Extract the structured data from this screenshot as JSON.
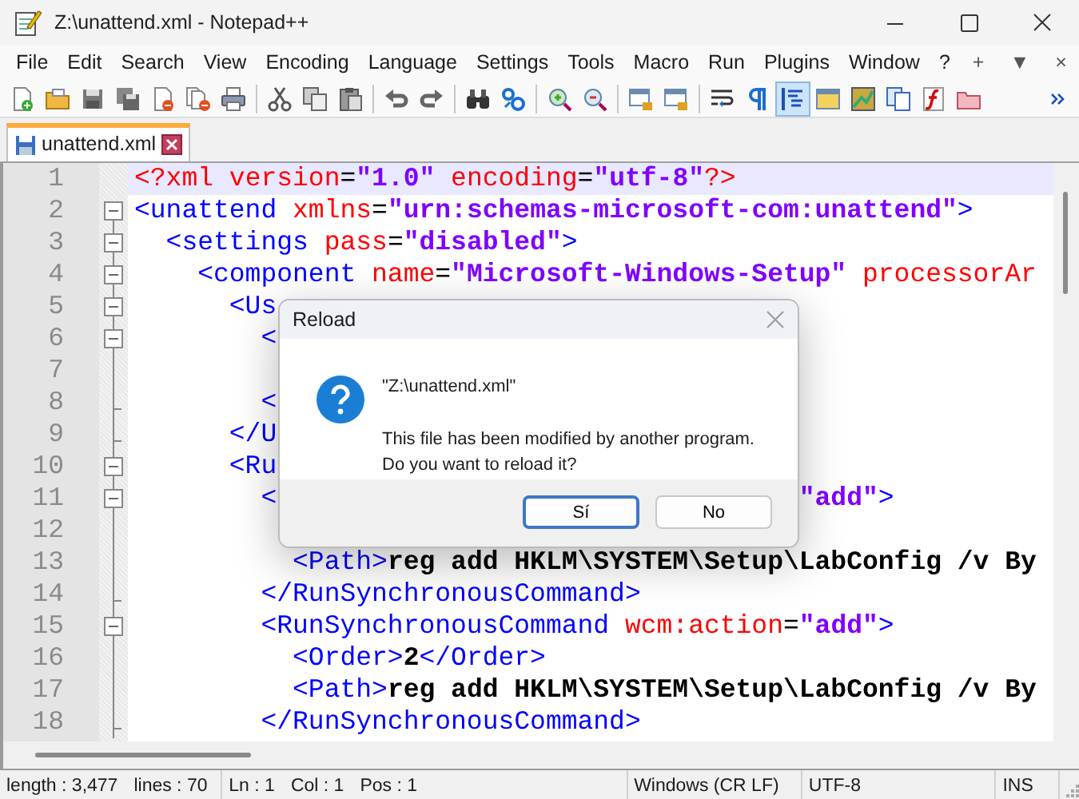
{
  "window": {
    "title": "Z:\\unattend.xml - Notepad++"
  },
  "menu": [
    "File",
    "Edit",
    "Search",
    "View",
    "Encoding",
    "Language",
    "Settings",
    "Tools",
    "Macro",
    "Run",
    "Plugins",
    "Window",
    "?"
  ],
  "menu_right": [
    "+",
    "▼",
    "×"
  ],
  "toolbar": [
    {
      "on": false
    },
    {
      "on": false
    },
    {
      "on": false
    },
    {
      "on": false
    },
    {
      "on": false
    },
    {
      "on": false
    },
    {
      "on": false
    },
    {
      "on": false
    },
    {
      "on": false
    },
    {
      "on": false
    },
    {
      "on": false
    },
    {
      "on": false
    },
    {
      "on": false
    },
    {
      "on": false
    },
    {
      "on": false
    },
    {
      "on": false
    },
    {
      "on": false
    },
    {
      "on": false
    },
    {
      "on": false
    },
    {
      "on": false
    },
    {
      "on": true
    },
    {
      "on": false
    },
    {
      "on": false
    },
    {
      "on": false
    },
    {
      "on": false
    },
    {
      "on": false
    }
  ],
  "tabs": [
    {
      "label": "unattend.xml",
      "selected": true
    }
  ],
  "editor": {
    "lines": [
      {
        "number": "1",
        "current": true,
        "fold": false,
        "fold_end": false,
        "tokens": [
          {
            "text": "<?xml",
            "kind": "pi"
          },
          {
            "text": " version",
            "kind": "attr"
          },
          {
            "text": "=",
            "kind": "op"
          },
          {
            "text": "\"1.0\"",
            "kind": "val"
          },
          {
            "text": " encoding",
            "kind": "attr"
          },
          {
            "text": "=",
            "kind": "op"
          },
          {
            "text": "\"utf-8\"",
            "kind": "val"
          },
          {
            "text": "?>",
            "kind": "pi"
          }
        ]
      },
      {
        "number": "2",
        "current": false,
        "fold": true,
        "fold_end": false,
        "tokens": [
          {
            "text": "<unattend",
            "kind": "tag"
          },
          {
            "text": " xmlns",
            "kind": "attr"
          },
          {
            "text": "=",
            "kind": "op"
          },
          {
            "text": "\"urn:schemas-microsoft-com:unattend\"",
            "kind": "val"
          },
          {
            "text": ">",
            "kind": "tag"
          }
        ]
      },
      {
        "number": "3",
        "current": false,
        "fold": true,
        "fold_end": false,
        "tokens": [
          {
            "text": "  <settings",
            "kind": "tag"
          },
          {
            "text": " pass",
            "kind": "attr"
          },
          {
            "text": "=",
            "kind": "op"
          },
          {
            "text": "\"disabled\"",
            "kind": "val"
          },
          {
            "text": ">",
            "kind": "tag"
          }
        ]
      },
      {
        "number": "4",
        "current": false,
        "fold": true,
        "fold_end": false,
        "tokens": [
          {
            "text": "    <component",
            "kind": "tag"
          },
          {
            "text": " name",
            "kind": "attr"
          },
          {
            "text": "=",
            "kind": "op"
          },
          {
            "text": "\"Microsoft-Windows-Setup\"",
            "kind": "val"
          },
          {
            "text": " processorAr",
            "kind": "attr"
          }
        ]
      },
      {
        "number": "5",
        "current": false,
        "fold": true,
        "fold_end": false,
        "tokens": [
          {
            "text": "      <Us",
            "kind": "tag"
          }
        ]
      },
      {
        "number": "6",
        "current": false,
        "fold": true,
        "fold_end": false,
        "tokens": [
          {
            "text": "        <",
            "kind": "tag"
          }
        ]
      },
      {
        "number": "7",
        "current": false,
        "fold": false,
        "fold_end": false
      },
      {
        "number": "8",
        "current": false,
        "fold": false,
        "fold_end": true,
        "tokens": [
          {
            "text": "        <",
            "kind": "tag"
          }
        ]
      },
      {
        "number": "9",
        "current": false,
        "fold": false,
        "fold_end": true,
        "tokens": [
          {
            "text": "      </U",
            "kind": "tag"
          }
        ]
      },
      {
        "number": "10",
        "current": false,
        "fold": true,
        "fold_end": false,
        "tokens": [
          {
            "text": "      <Ru",
            "kind": "tag"
          }
        ]
      },
      {
        "number": "11",
        "current": false,
        "fold": true,
        "fold_end": false,
        "tokens": [
          {
            "text": "        <",
            "kind": "tag"
          }
        ],
        "tail": [
          {
            "text": "\"add\"",
            "kind": "val"
          },
          {
            "text": ">",
            "kind": "tag"
          }
        ]
      },
      {
        "number": "12",
        "current": false,
        "fold": false,
        "fold_end": false
      },
      {
        "number": "13",
        "current": false,
        "fold": false,
        "fold_end": false,
        "tokens": [
          {
            "text": "          <Path>",
            "kind": "tag"
          },
          {
            "text": "reg add HKLM\\SYSTEM\\Setup\\LabConfig /v By",
            "kind": "text"
          }
        ]
      },
      {
        "number": "14",
        "current": false,
        "fold": false,
        "fold_end": true,
        "tokens": [
          {
            "text": "        </RunSynchronousCommand>",
            "kind": "tag"
          }
        ]
      },
      {
        "number": "15",
        "current": false,
        "fold": true,
        "fold_end": false,
        "tokens": [
          {
            "text": "        <RunSynchronousCommand",
            "kind": "tag"
          },
          {
            "text": " wcm:action",
            "kind": "attr"
          },
          {
            "text": "=",
            "kind": "op"
          },
          {
            "text": "\"add\"",
            "kind": "val"
          },
          {
            "text": ">",
            "kind": "tag"
          }
        ]
      },
      {
        "number": "16",
        "current": false,
        "fold": false,
        "fold_end": false,
        "tokens": [
          {
            "text": "          <Order>",
            "kind": "tag"
          },
          {
            "text": "2",
            "kind": "text"
          },
          {
            "text": "</Order>",
            "kind": "tag"
          }
        ]
      },
      {
        "number": "17",
        "current": false,
        "fold": false,
        "fold_end": false,
        "tokens": [
          {
            "text": "          <Path>",
            "kind": "tag"
          },
          {
            "text": "reg add HKLM\\SYSTEM\\Setup\\LabConfig /v By",
            "kind": "text"
          }
        ]
      },
      {
        "number": "18",
        "current": false,
        "fold": false,
        "fold_end": true,
        "tokens": [
          {
            "text": "        </RunSynchronousCommand>",
            "kind": "tag"
          }
        ]
      }
    ]
  },
  "dialog": {
    "title": "Reload",
    "file": "\"Z:\\unattend.xml\"",
    "message": [
      "This file has been modified by another program.",
      "Do you want to reload it?"
    ],
    "buttons": [
      {
        "label": "Sí",
        "default": true
      },
      {
        "label": "No",
        "default": false
      }
    ]
  },
  "status_bar": {
    "length": "length : 3,477",
    "lines": "lines : 70",
    "ln": "Ln : 1",
    "col": "Col : 1",
    "pos": "Pos : 1",
    "eol": "Windows (CR LF)",
    "encoding": "UTF-8",
    "mode": "INS"
  }
}
